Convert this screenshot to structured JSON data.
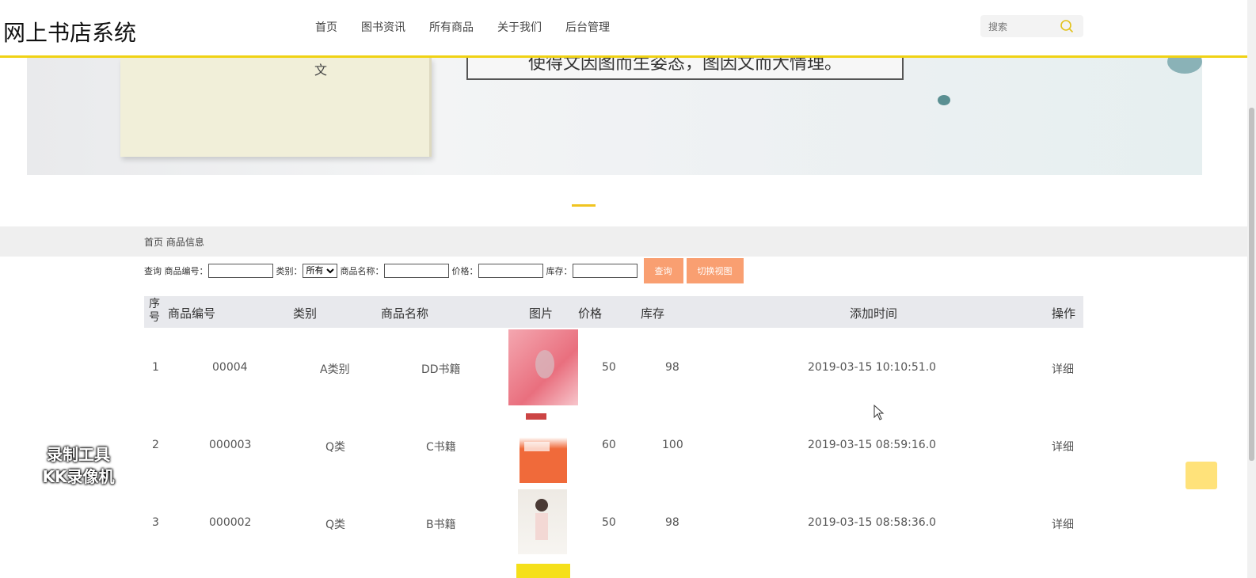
{
  "header": {
    "brand": "网上书店系统",
    "nav": [
      "首页",
      "图书资讯",
      "所有商品",
      "关于我们",
      "后台管理"
    ],
    "search_placeholder": "搜索"
  },
  "banner": {
    "slogan": "使得文因图而生姿态，图因文而大情理。",
    "book_char": "文"
  },
  "breadcrumb": "首页 商品信息",
  "query": {
    "label_query": "查询",
    "label_code": "商品编号：",
    "label_category": "类别：",
    "category_selected": "所有",
    "label_name": "商品名称：",
    "label_price": "价格：",
    "label_stock": "库存：",
    "btn_query": "查询",
    "btn_switch": "切换视图"
  },
  "table": {
    "headers": {
      "seq": "序号",
      "code": "商品编号",
      "category": "类别",
      "name": "商品名称",
      "image": "图片",
      "price": "价格",
      "stock": "库存",
      "time": "添加时间",
      "op": "操作"
    },
    "rows": [
      {
        "seq": "1",
        "code": "00004",
        "category": "A类别",
        "name": "DD书籍",
        "price": "50",
        "stock": "98",
        "time": "2019-03-15 10:10:51.0",
        "op": "详细"
      },
      {
        "seq": "2",
        "code": "000003",
        "category": "Q类",
        "name": "C书籍",
        "price": "60",
        "stock": "100",
        "time": "2019-03-15 08:59:16.0",
        "op": "详细"
      },
      {
        "seq": "3",
        "code": "000002",
        "category": "Q类",
        "name": "B书籍",
        "price": "50",
        "stock": "98",
        "time": "2019-03-15 08:58:36.0",
        "op": "详细"
      }
    ]
  },
  "watermark": {
    "line1": "录制工具",
    "line2": "KK录像机"
  },
  "colors": {
    "accent_yellow": "#f0d214",
    "button_orange": "#f99f71",
    "header_bg": "#e8e9ed"
  }
}
